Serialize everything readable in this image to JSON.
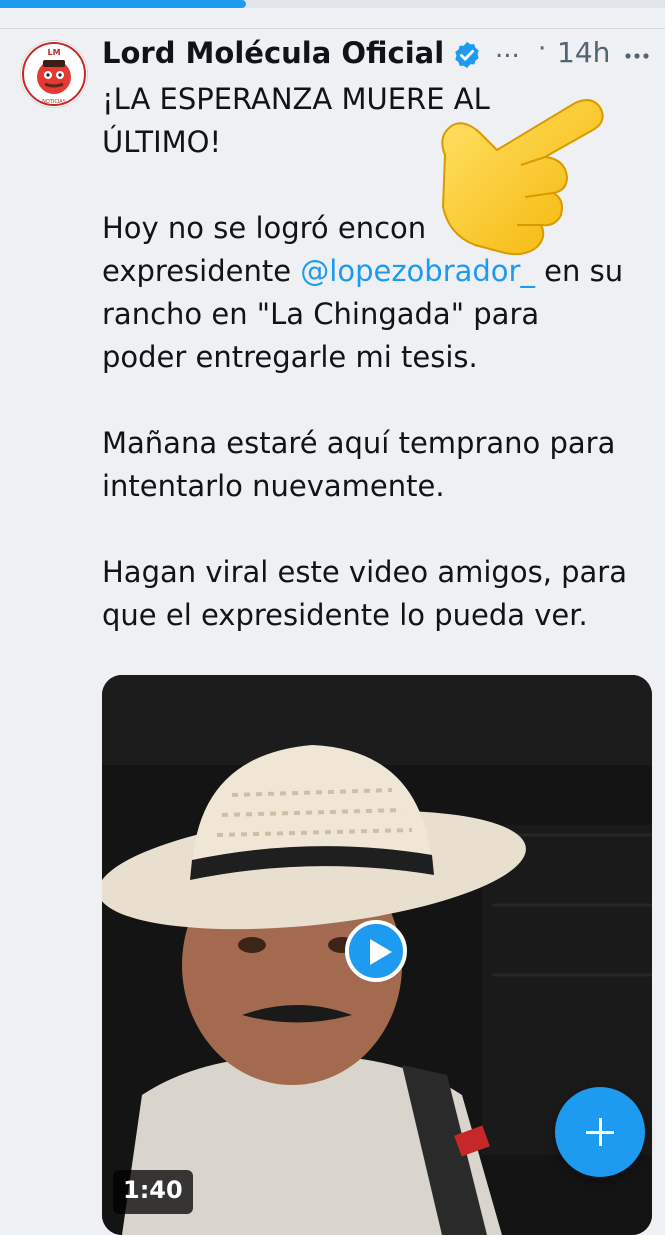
{
  "status": {
    "progress_fraction": 0.37
  },
  "colors": {
    "accent": "#1d9bf0",
    "text": "#0f1419",
    "muted": "#536471",
    "background": "#eef0f3"
  },
  "tweet": {
    "author": {
      "name": "Lord Molécula Oficial",
      "verified": true,
      "avatar_icon": "lm-noticias-logo",
      "avatar_letters": "LM",
      "avatar_ring_text": "NOTICIAS"
    },
    "name_truncation": "...",
    "separator": "·",
    "time": "14h",
    "text": {
      "line1": "¡LA ESPERANZA MUERE AL",
      "line2": "ÚLTIMO!",
      "line3": "Hoy no se logró encon",
      "line4_before": "expresidente ",
      "mention": "@lopezobrador_",
      "line4_after": " en su",
      "line5": "rancho en \"La Chingada\" para",
      "line6": "poder entregarle mi tesis.",
      "line7": "Mañana estaré aquí temprano para",
      "line8": "intentarlo nuevamente.",
      "line9": "Hagan viral este video amigos, para",
      "line10": "que el expresidente lo pueda ver."
    },
    "overlay_emoji": "backhand-index-pointing-right",
    "media": {
      "type": "video",
      "duration": "1:40",
      "play_icon": "play-icon"
    }
  },
  "fab": {
    "icon": "plus-icon"
  }
}
